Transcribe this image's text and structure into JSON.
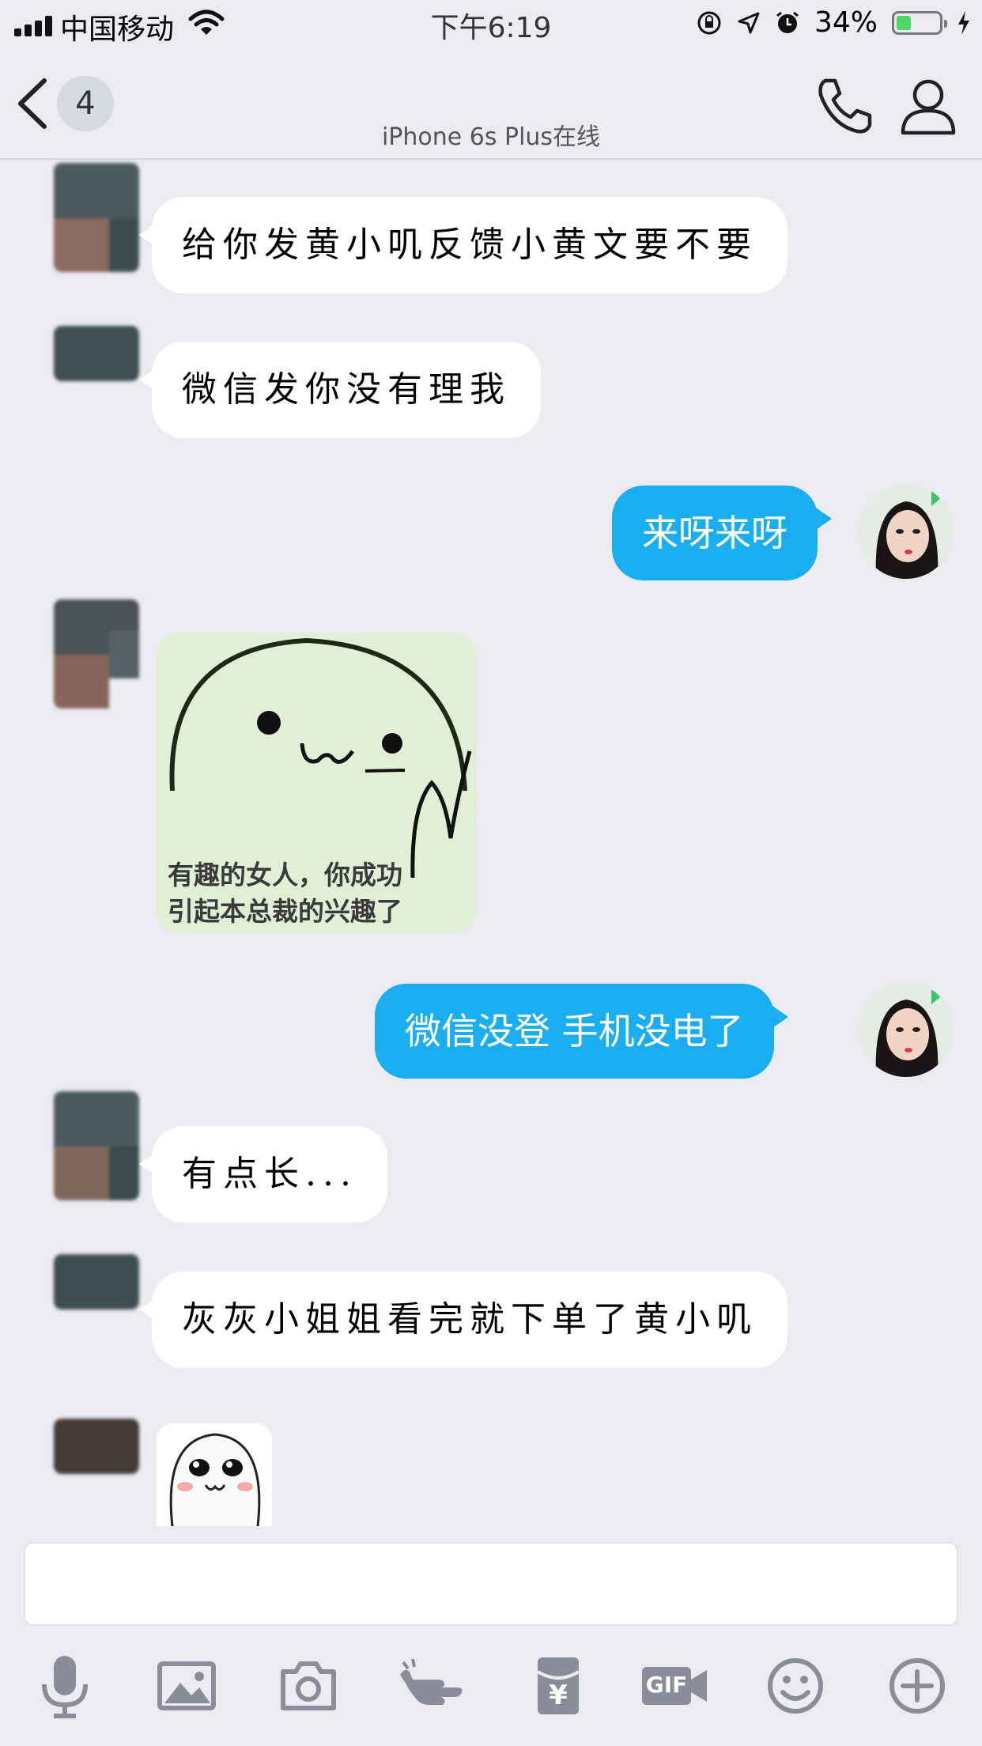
{
  "status_bar": {
    "carrier": "中国移动",
    "time": "下午6:19",
    "battery_percent": "34%",
    "battery_level": 0.34,
    "battery_color": "#4cd964"
  },
  "nav": {
    "back_icon": "chevron-left-icon",
    "unread_count": "4",
    "subtitle": "iPhone 6s Plus在线",
    "call_icon": "phone-icon",
    "profile_icon": "person-icon"
  },
  "messages": [
    {
      "side": "in",
      "type": "text",
      "text": "给你发黄小叽反馈小黄文要不要"
    },
    {
      "side": "in",
      "type": "text",
      "text": "微信发你没有理我"
    },
    {
      "side": "out",
      "type": "text",
      "text": "来呀来呀"
    },
    {
      "side": "in",
      "type": "sticker",
      "caption_line1": "有趣的女人，你成功",
      "caption_line2": "引起本总裁的兴趣了"
    },
    {
      "side": "out",
      "type": "text",
      "text": "微信没登   手机没电了"
    },
    {
      "side": "in",
      "type": "text",
      "text": "有点长..."
    },
    {
      "side": "in",
      "type": "text",
      "text": "灰灰小姐姐看完就下单了黄小叽"
    },
    {
      "side": "in",
      "type": "sticker",
      "caption_line1": "",
      "caption_line2": ""
    }
  ],
  "colors": {
    "background": "#ebebf1",
    "outgoing_bubble": "#1aaef0",
    "incoming_bubble": "#ffffff",
    "icon_gray": "#8a8d99"
  },
  "toolbar": {
    "items": [
      "microphone-icon",
      "image-icon",
      "camera-icon",
      "poke-hand-icon",
      "red-packet-icon",
      "gif-icon",
      "emoji-icon",
      "plus-icon"
    ],
    "gif_label": "GIF",
    "red_packet_symbol": "¥"
  }
}
